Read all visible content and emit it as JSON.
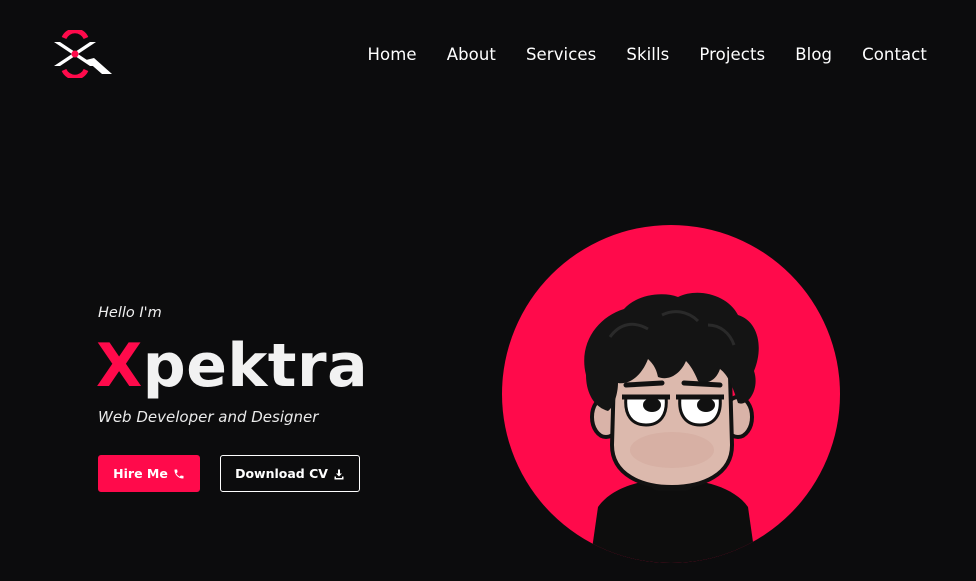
{
  "nav": {
    "items": [
      {
        "label": "Home"
      },
      {
        "label": "About"
      },
      {
        "label": "Services"
      },
      {
        "label": "Skills"
      },
      {
        "label": "Projects"
      },
      {
        "label": "Blog"
      },
      {
        "label": "Contact"
      }
    ]
  },
  "hero": {
    "greeting": "Hello I'm",
    "name_first_letter": "X",
    "name_rest": "pektra",
    "role": "Web Developer and Designer"
  },
  "buttons": {
    "hire_label": "Hire Me",
    "hire_icon": "phone-icon",
    "cv_label": "Download CV",
    "cv_icon": "download-icon"
  },
  "colors": {
    "background": "#0c0c0d",
    "accent": "#ff0a4b",
    "text": "#ffffff"
  }
}
